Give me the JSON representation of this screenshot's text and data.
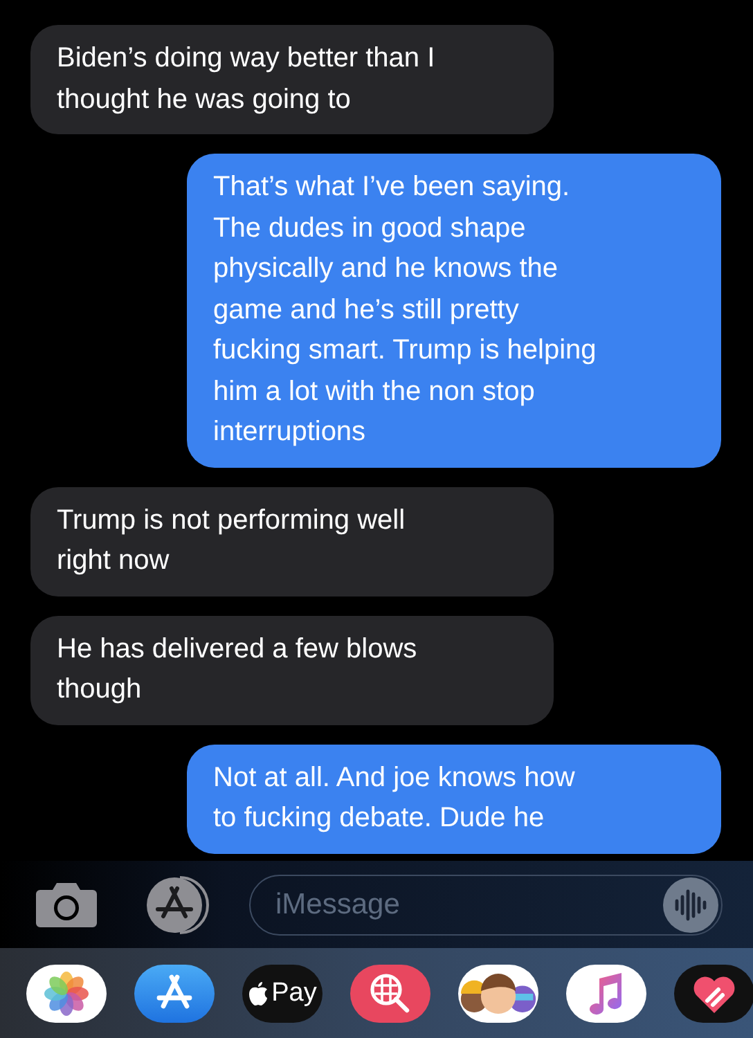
{
  "messages": [
    {
      "kind": "received",
      "lines": [
        "Biden’s doing way better than I",
        "thought he was going to"
      ]
    },
    {
      "kind": "sent",
      "lines": [
        "That’s what I’ve been saying.",
        "The dudes in good shape",
        "physically and he knows the",
        "game and he’s still pretty",
        "fucking smart. Trump is helping",
        "him a lot with the non stop",
        "interruptions"
      ]
    },
    {
      "kind": "received",
      "lines": [
        "Trump is not performing well",
        "right now"
      ]
    },
    {
      "kind": "received",
      "lines": [
        "He has delivered a few blows",
        "though"
      ]
    },
    {
      "kind": "sent",
      "lines": [
        "Not at all. And joe knows how",
        "to fucking debate. Dude he"
      ]
    }
  ],
  "compose": {
    "placeholder": "iMessage"
  },
  "apps": [
    {
      "kind": "photos"
    },
    {
      "kind": "appstore"
    },
    {
      "kind": "pay",
      "label": "Pay"
    },
    {
      "kind": "search"
    },
    {
      "kind": "memoji"
    },
    {
      "kind": "music"
    },
    {
      "kind": "heart"
    }
  ]
}
